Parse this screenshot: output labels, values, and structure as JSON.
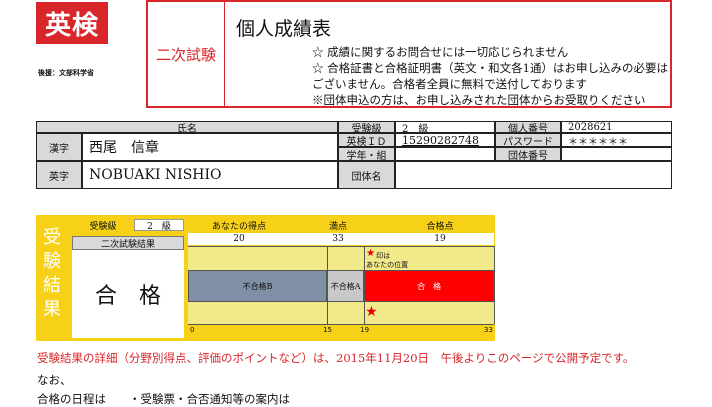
{
  "header": {
    "logo_text": "英検",
    "logo_sub": "後援：文部科学省",
    "exam_type": "二次試験",
    "doc_title": "個人成績表",
    "notices": [
      "☆ 成績に関するお問合せには一切応じられません",
      "☆ 合格証書と合格証明書（英文・和文各1通）はお申し込みの必要は",
      "ございません。合格者全員に無料で送付しております",
      "※団体申込の方は、お申し込みされた団体からお受取りください"
    ]
  },
  "info": {
    "name_header": "氏名",
    "kanji_label": "漢字",
    "kanji_name": "西尾　信章",
    "eiji_label": "英字",
    "eiji_name": "NOBUAKI NISHIO",
    "grade_label": "受験級",
    "grade_value": "2　級",
    "eiken_id_label": "英検ＩＤ",
    "eiken_id_value": "15290282748",
    "school_label": "学年・組",
    "school_value": "",
    "personal_no_label": "個人番号",
    "personal_no_value": "2028621",
    "password_label": "パスワード",
    "password_value": "＊＊＊＊＊＊",
    "group_no_label": "団体番号",
    "group_no_value": "",
    "group_name_label": "団体名",
    "group_name_value": ""
  },
  "result": {
    "side_label": [
      "受",
      "験",
      "結",
      "果"
    ],
    "grade_label": "受験級",
    "grade_value": "2　級",
    "your_score_label": "あなたの得点",
    "your_score": "20",
    "full_score_label": "満点",
    "full_score": "33",
    "pass_score_label": "合格点",
    "pass_score": "19",
    "result_header": "二次試験結果",
    "result_value": "合　格"
  },
  "chart_data": {
    "type": "bar",
    "score": 20,
    "bands": [
      {
        "label": "不合格B",
        "from": 0,
        "to": 15,
        "color": "#7f8fa6"
      },
      {
        "label": "不合格A",
        "from": 15,
        "to": 19,
        "color": "#c8c8c8"
      },
      {
        "label": "合　格",
        "from": 19,
        "to": 33,
        "color": "#ff0000"
      }
    ],
    "ticks": [
      "0",
      "15",
      "19",
      "33"
    ],
    "xlim": [
      0,
      33
    ],
    "legend_star": "★",
    "legend_text_1": "印は",
    "legend_text_2": "あなたの位置",
    "marker_symbol": "★"
  },
  "footer": {
    "line1": "受験結果の詳細（分野別得点、評価のポイントなど）は、2015年11月20日　午後よりこのページで公開予定です。",
    "line2": "なお、",
    "line3": "合格の日程は　　・受験票・合否通知等の案内は"
  }
}
